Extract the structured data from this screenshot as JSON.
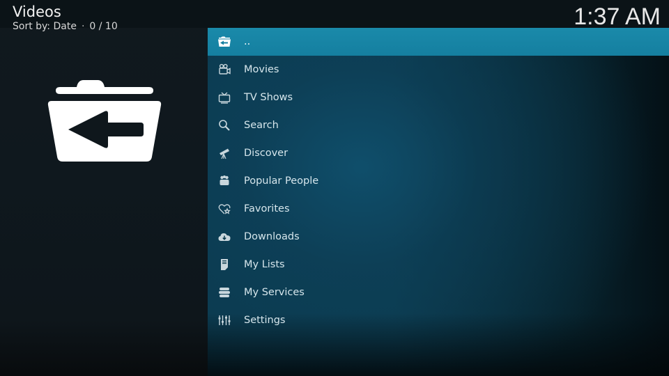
{
  "header": {
    "title": "Videos",
    "sort_label": "Sort by: Date",
    "separator": "·",
    "count": "0 / 10"
  },
  "clock": "1:37 AM",
  "preview": {
    "icon": "folder-back-icon"
  },
  "list": {
    "items": [
      {
        "label": "..",
        "icon": "folder-back-icon",
        "selected": true
      },
      {
        "label": "Movies",
        "icon": "movie-camera-icon"
      },
      {
        "label": "TV Shows",
        "icon": "tv-icon"
      },
      {
        "label": "Search",
        "icon": "search-icon"
      },
      {
        "label": "Discover",
        "icon": "telescope-icon"
      },
      {
        "label": "Popular People",
        "icon": "people-icon"
      },
      {
        "label": "Favorites",
        "icon": "heart-star-icon"
      },
      {
        "label": "Downloads",
        "icon": "cloud-download-icon"
      },
      {
        "label": "My Lists",
        "icon": "list-document-icon"
      },
      {
        "label": "My Services",
        "icon": "services-stack-icon"
      },
      {
        "label": "Settings",
        "icon": "settings-sliders-icon"
      }
    ]
  },
  "colors": {
    "accent": "#1686a6",
    "text": "#d6e6ec",
    "background_left": "#10181d",
    "background_right": "#0b3a4e"
  }
}
